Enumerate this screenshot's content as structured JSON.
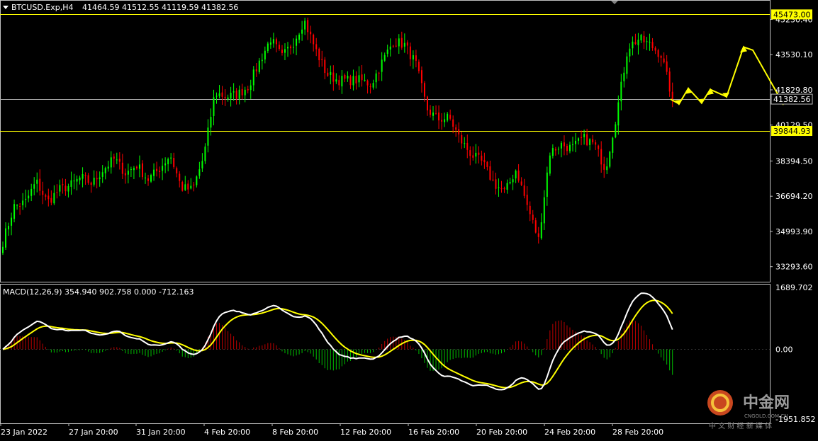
{
  "header": {
    "symbol_timeframe": "BTCUSD.Exp,H4",
    "ohlc": "41464.59 41512.55 41119.59 41382.56"
  },
  "indicator": {
    "label": "MACD(12,26,9) 354.940 902.758 0.000 -712.163"
  },
  "watermark": {
    "brand": "中金网",
    "domain": "CNGOLD.COM.CN",
    "tagline": "中 文 财 经 新 媒 体"
  },
  "colors": {
    "background": "#000000",
    "bull": "#00ff00",
    "bear": "#ff0000",
    "level_line": "#ffff00",
    "current_price_line": "#aaaaaa",
    "axis_text": "#ffffff",
    "macd_line": "#ffffff",
    "signal_line": "#ffff00"
  },
  "chart_data": [
    {
      "type": "candlestick",
      "symbol": "BTCUSD.Exp",
      "timeframe": "H4",
      "ylim": [
        32600,
        46100
      ],
      "y_ticks": [
        {
          "value": 45230.4,
          "label": "45230.40"
        },
        {
          "value": 43530.1,
          "label": "43530.10"
        },
        {
          "value": 41829.8,
          "label": "41829.80"
        },
        {
          "value": 40129.5,
          "label": "40129.50"
        },
        {
          "value": 38394.5,
          "label": "38394.50"
        },
        {
          "value": 36694.2,
          "label": "36694.20"
        },
        {
          "value": 34993.9,
          "label": "34993.90"
        },
        {
          "value": 33293.6,
          "label": "33293.60"
        }
      ],
      "x_ticks": [
        "23 Jan 2022",
        "27 Jan 20:00",
        "31 Jan 20:00",
        "4 Feb 20:00",
        "8 Feb 20:00",
        "12 Feb 20:00",
        "16 Feb 20:00",
        "20 Feb 20:00",
        "24 Feb 20:00",
        "28 Feb 20:00"
      ],
      "horizontal_levels": [
        {
          "value": 45473.0,
          "label": "45473.00",
          "color": "#ffff00"
        },
        {
          "value": 39844.93,
          "label": "39844.93",
          "color": "#ffff00"
        }
      ],
      "current_price": {
        "value": 41382.56,
        "label": "41382.56"
      },
      "path_waypoints_close": [
        34500,
        36200,
        36400,
        37400,
        36400,
        37000,
        37200,
        37600,
        37300,
        38000,
        38500,
        37800,
        38200,
        37500,
        38000,
        38700,
        37100,
        37000,
        38600,
        41700,
        41500,
        41600,
        42000,
        43200,
        44300,
        43400,
        44100,
        45200,
        43800,
        42600,
        42300,
        42300,
        42300,
        42100,
        43200,
        44200,
        44000,
        43100,
        40900,
        40400,
        40500,
        39400,
        38700,
        38300,
        37300,
        36900,
        38000,
        36200,
        34600,
        38800,
        39200,
        39000,
        39500,
        39200,
        38000,
        40700,
        43900,
        44300,
        44000,
        43500,
        41380
      ],
      "projection_path": [
        41380,
        41150,
        41900,
        41200,
        41850,
        41500,
        43900,
        43750,
        41150
      ]
    },
    {
      "type": "macd",
      "name": "MACD(12,26,9)",
      "values": {
        "histogram": 354.94,
        "macd": 902.758,
        "zero": 0.0,
        "signal": -712.163
      },
      "y_ticks": [
        {
          "value": 1689.702,
          "label": "1689.702"
        },
        {
          "value": 0.0,
          "label": "0.00"
        },
        {
          "value": -1951.852,
          "label": "-1951.852"
        }
      ],
      "ylim": [
        -2000,
        1750
      ]
    }
  ]
}
